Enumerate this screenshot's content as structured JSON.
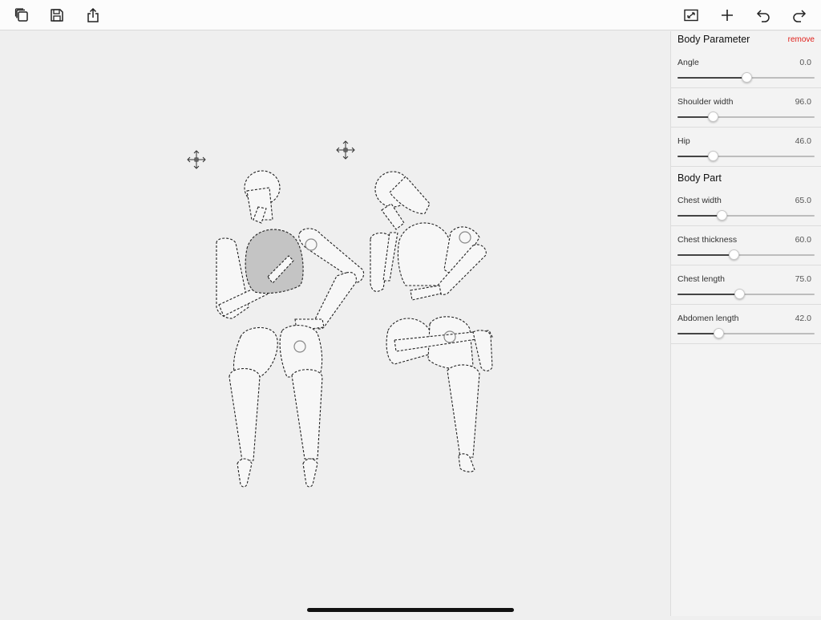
{
  "toolbar": {
    "left": [
      {
        "name": "duplicate-button",
        "icon": "duplicate-icon"
      },
      {
        "name": "save-button",
        "icon": "save-icon"
      },
      {
        "name": "share-button",
        "icon": "share-icon"
      }
    ],
    "right": [
      {
        "name": "fit-screen-button",
        "icon": "fit-screen-icon"
      },
      {
        "name": "add-button",
        "icon": "plus-icon"
      },
      {
        "name": "undo-button",
        "icon": "undo-icon"
      },
      {
        "name": "redo-button",
        "icon": "redo-icon"
      }
    ]
  },
  "panel": {
    "body_parameter": {
      "title": "Body Parameter",
      "remove_label": "remove",
      "params": [
        {
          "label": "Angle",
          "value": "0.0",
          "fraction": 0.5
        },
        {
          "label": "Shoulder width",
          "value": "96.0",
          "fraction": 0.26
        },
        {
          "label": "Hip",
          "value": "46.0",
          "fraction": 0.26
        }
      ]
    },
    "body_part": {
      "title": "Body Part",
      "params": [
        {
          "label": "Chest width",
          "value": "65.0",
          "fraction": 0.32
        },
        {
          "label": "Chest thickness",
          "value": "60.0",
          "fraction": 0.41
        },
        {
          "label": "Chest length",
          "value": "75.0",
          "fraction": 0.45
        },
        {
          "label": "Abdomen length",
          "value": "42.0",
          "fraction": 0.3
        }
      ]
    }
  },
  "colors": {
    "accent_remove": "#e0201b",
    "selected_part": "#c4c4c4"
  }
}
